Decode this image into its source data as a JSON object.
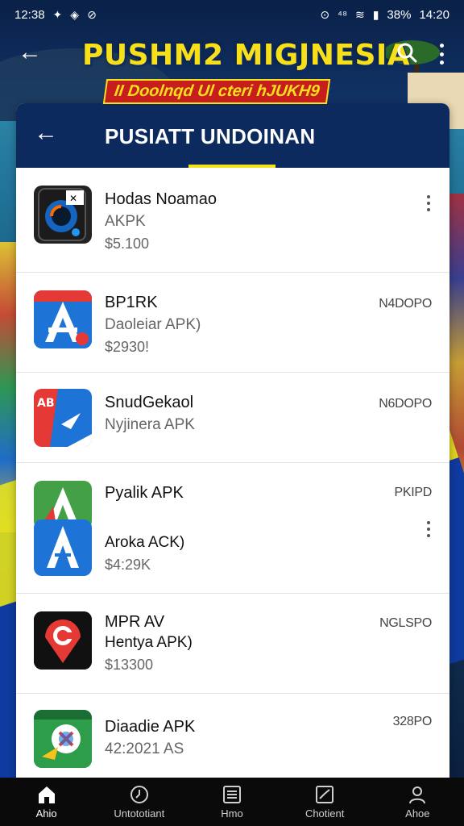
{
  "status_bar": {
    "time_left": "12:38",
    "icons_left": [
      "vibrate-icon",
      "shield-icon",
      "app-icon"
    ],
    "battery": "38%",
    "time_right": "14:20"
  },
  "header": {
    "title": "PUSHM2 MIGJNESIA",
    "subtitle": "II Doolnqd Ul cteri hJUKH9",
    "brand_colors": {
      "title": "#f7e01a",
      "banner": "#c71d1d"
    }
  },
  "card": {
    "title": "PUSIATT UNDOINAN",
    "header_color": "#0d2a5f",
    "accent": "#f3e31b"
  },
  "apps": [
    {
      "name": "Hodas Noamao",
      "sub": "AKPK",
      "price": "$5.100",
      "badge": "",
      "menu": true
    },
    {
      "name": "BP1RK",
      "sub": "Daoleiar APK)",
      "price": "$2930!",
      "badge": "N4DOPO",
      "menu": false
    },
    {
      "name": "SnudGekaol",
      "sub": "Nyjinera APK",
      "price": "",
      "badge": "N6DOPO",
      "menu": false
    },
    {
      "name": "Pyalik APK",
      "sub": "Aroka ACK)",
      "price": "$4:29K",
      "badge": "PKIPD",
      "menu": true
    },
    {
      "name": "MPR AV",
      "sub": "Hentya APK)",
      "price": "$13300",
      "badge": "NGLSPO",
      "menu": false
    },
    {
      "name": "Diaadie APK",
      "sub": "42:2021 AS",
      "price": "",
      "badge": "328PO",
      "menu": false
    }
  ],
  "bottom_nav": [
    {
      "label": "Ahio",
      "icon": "home-icon",
      "active": true
    },
    {
      "label": "Untototiant",
      "icon": "clock-icon",
      "active": false
    },
    {
      "label": "Hmo",
      "icon": "list-icon",
      "active": false
    },
    {
      "label": "Chotient",
      "icon": "chart-icon",
      "active": false
    },
    {
      "label": "Ahoe",
      "icon": "profile-icon",
      "active": false
    }
  ]
}
